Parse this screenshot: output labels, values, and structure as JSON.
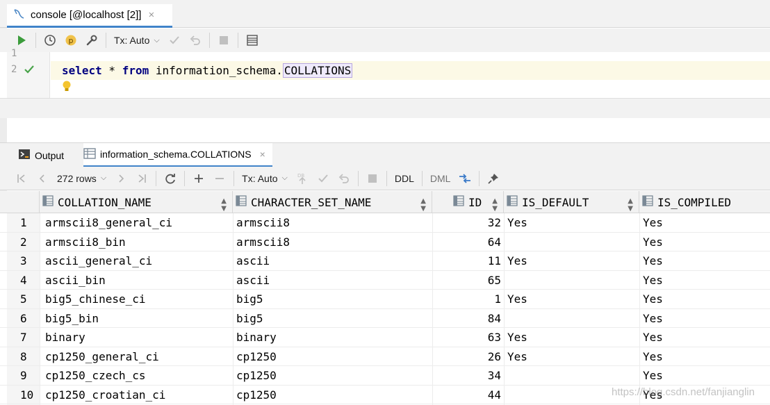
{
  "editor_tab": {
    "title": "console [@localhost [2]]",
    "close": "×"
  },
  "editor_toolbar": {
    "tx_mode": "Tx: Auto"
  },
  "editor": {
    "line_numbers": [
      "1",
      "2"
    ],
    "code_keyword_select": "select",
    "code_star": " * ",
    "code_keyword_from": "from",
    "code_schema": " information_schema.",
    "code_table": "COLLATIONS"
  },
  "results_tabs": {
    "output_label": "Output",
    "table_label": "information_schema.COLLATIONS",
    "close": "×"
  },
  "results_toolbar": {
    "rows_label": "272 rows",
    "tx_mode": "Tx: Auto",
    "ddl_label": "DDL",
    "dml_label": "DML"
  },
  "grid": {
    "columns": [
      "COLLATION_NAME",
      "CHARACTER_SET_NAME",
      "ID",
      "IS_DEFAULT",
      "IS_COMPILED"
    ],
    "rows": [
      {
        "n": "1",
        "collation": "armscii8_general_ci",
        "charset": "armscii8",
        "id": "32",
        "is_default": "Yes",
        "is_compiled": "Yes"
      },
      {
        "n": "2",
        "collation": "armscii8_bin",
        "charset": "armscii8",
        "id": "64",
        "is_default": "",
        "is_compiled": "Yes"
      },
      {
        "n": "3",
        "collation": "ascii_general_ci",
        "charset": "ascii",
        "id": "11",
        "is_default": "Yes",
        "is_compiled": "Yes"
      },
      {
        "n": "4",
        "collation": "ascii_bin",
        "charset": "ascii",
        "id": "65",
        "is_default": "",
        "is_compiled": "Yes"
      },
      {
        "n": "5",
        "collation": "big5_chinese_ci",
        "charset": "big5",
        "id": "1",
        "is_default": "Yes",
        "is_compiled": "Yes"
      },
      {
        "n": "6",
        "collation": "big5_bin",
        "charset": "big5",
        "id": "84",
        "is_default": "",
        "is_compiled": "Yes"
      },
      {
        "n": "7",
        "collation": "binary",
        "charset": "binary",
        "id": "63",
        "is_default": "Yes",
        "is_compiled": "Yes"
      },
      {
        "n": "8",
        "collation": "cp1250_general_ci",
        "charset": "cp1250",
        "id": "26",
        "is_default": "Yes",
        "is_compiled": "Yes"
      },
      {
        "n": "9",
        "collation": "cp1250_czech_cs",
        "charset": "cp1250",
        "id": "34",
        "is_default": "",
        "is_compiled": "Yes"
      },
      {
        "n": "10",
        "collation": "cp1250_croatian_ci",
        "charset": "cp1250",
        "id": "44",
        "is_default": "",
        "is_compiled": "Yes"
      }
    ]
  },
  "watermark": "https://blog.csdn.net/fanjianglin",
  "colors": {
    "accent": "#4083c9",
    "run_green": "#3b9c3b",
    "keyword": "#000080"
  }
}
